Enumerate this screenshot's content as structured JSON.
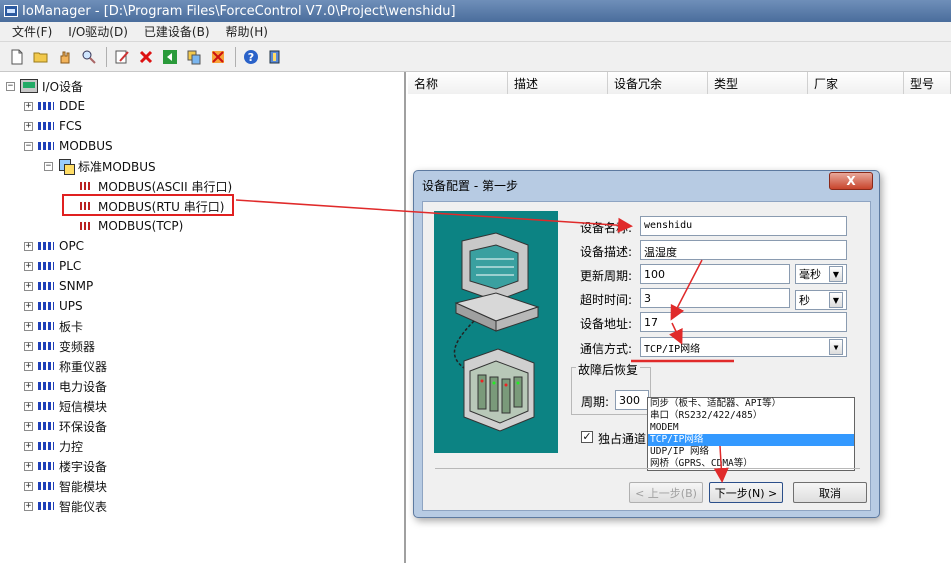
{
  "window": {
    "title": "IoManager - [D:\\Program Files\\ForceControl V7.0\\Project\\wenshidu]"
  },
  "menu": {
    "items": [
      "文件(F)",
      "I/O驱动(D)",
      "已建设备(B)",
      "帮助(H)"
    ]
  },
  "toolbar": {
    "icons": [
      "new-file-icon",
      "open-folder-icon",
      "hand-icon",
      "search-icon",
      "edit-icon",
      "delete-icon",
      "green-arrow-icon",
      "copy-icon",
      "delete-all-icon",
      "help-icon",
      "info-icon"
    ]
  },
  "tree": {
    "root": "I/O设备",
    "items": [
      "DDE",
      "FCS",
      "MODBUS",
      "OPC",
      "PLC",
      "SNMP",
      "UPS",
      "板卡",
      "变频器",
      "称重仪器",
      "电力设备",
      "短信模块",
      "环保设备",
      "力控",
      "楼宇设备",
      "智能模块",
      "智能仪表"
    ],
    "modbus_child": "标准MODBUS",
    "modbus_ports": [
      "MODBUS(ASCII 串行口)",
      "MODBUS(RTU 串行口)",
      "MODBUS(TCP)"
    ]
  },
  "list": {
    "columns": [
      "名称",
      "描述",
      "设备冗余",
      "类型",
      "厂家",
      "型号"
    ]
  },
  "dialog": {
    "title": "设备配置 - 第一步",
    "close_glyph": "X",
    "device_name_label": "设备名称:",
    "device_name": "wenshidu",
    "device_desc_label": "设备描述:",
    "device_desc": "温湿度",
    "update_period_label": "更新周期:",
    "update_period": "100",
    "update_unit": "毫秒",
    "timeout_label": "超时时间:",
    "timeout": "3",
    "timeout_unit": "秒",
    "address_label": "设备地址:",
    "address": "17",
    "comm_label": "通信方式:",
    "comm_value": "TCP/IP网络",
    "comm_options": [
      "同步（板卡、适配器、API等）",
      "串口（RS232/422/485）",
      "MODEM",
      "TCP/IP网络",
      "UDP/IP 网络",
      "网桥（GPRS、CDMA等）"
    ],
    "comm_selected_index": 3,
    "fault_group_label": "故障后恢复",
    "period_label": "周期:",
    "period_value": "300",
    "exclusive_label": "独占通道",
    "advanced_fragment": "高级",
    "prev_button": "< 上一步(B)",
    "next_button": "下一步(N) >",
    "cancel_button": "取消"
  }
}
